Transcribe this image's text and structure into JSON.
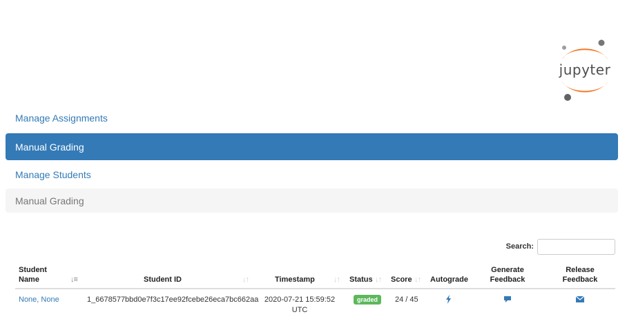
{
  "logo": {
    "text": "jupyter"
  },
  "nav": {
    "manage_assignments": "Manage Assignments",
    "manual_grading": "Manual Grading",
    "manage_students": "Manage Students"
  },
  "breadcrumb": {
    "current": "Manual Grading"
  },
  "search": {
    "label": "Search:",
    "value": ""
  },
  "table": {
    "headers": {
      "student_name_1": "Student",
      "student_name_2": "Name",
      "student_id": "Student ID",
      "timestamp": "Timestamp",
      "status": "Status",
      "score": "Score",
      "autograde": "Autograde",
      "generate_feedback_1": "Generate",
      "generate_feedback_2": "Feedback",
      "release_feedback_1": "Release",
      "release_feedback_2": "Feedback"
    },
    "rows": [
      {
        "student_name": "None, None",
        "student_id": "1_6678577bbd0e7f3c17ee92fcebe26eca7bc662aa",
        "timestamp_1": "2020-07-21 15:59:52",
        "timestamp_2": "UTC",
        "status": "graded",
        "score": "24 / 45",
        "autograde_icon": "bolt-icon",
        "generate_feedback_icon": "comment-icon",
        "release_feedback_icon": "envelope-icon"
      }
    ]
  },
  "colors": {
    "primary": "#337ab7",
    "success": "#5cb85c",
    "jupyter_orange": "#f37726",
    "muted_bg": "#f5f5f5"
  }
}
